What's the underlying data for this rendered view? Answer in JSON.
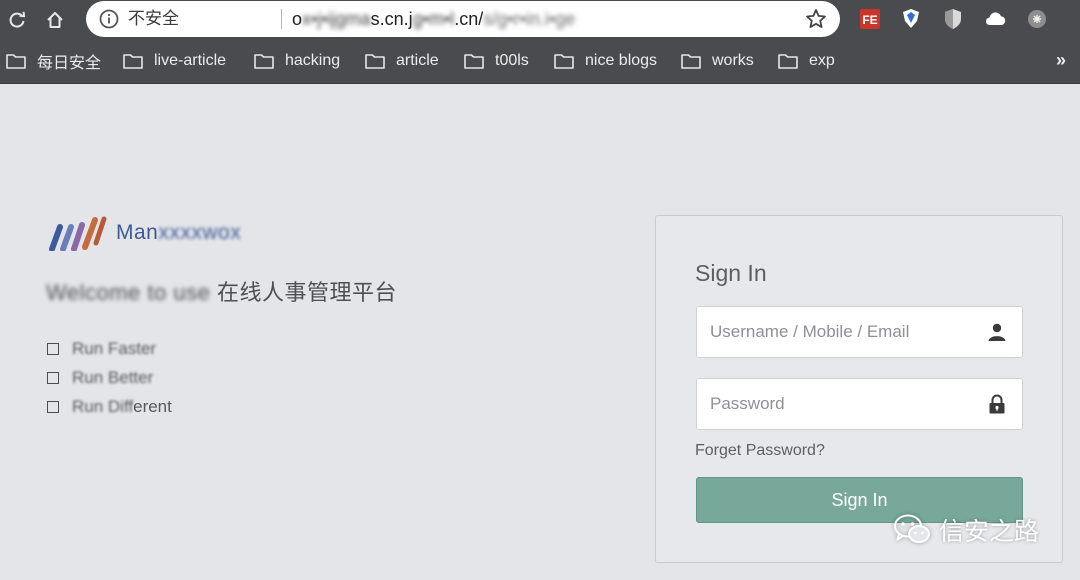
{
  "browser": {
    "security_label": "不安全",
    "url": {
      "part1": "o",
      "part2": "x•j•ijgma",
      "part3": "s.cn.j",
      "part4": "g•m•l",
      "part5": ".cn/",
      "part6": "s/g•r•i",
      "part7": "n.i•ge"
    }
  },
  "extensions": [
    "fe-extension-icon",
    "shield-diamond-icon",
    "shield-icon",
    "cloud-icon",
    "grey-badge-icon"
  ],
  "fe_label": "FE",
  "bookmarks": {
    "items": [
      {
        "label": "每日安全"
      },
      {
        "label": "live-article"
      },
      {
        "label": "hacking"
      },
      {
        "label": "article"
      },
      {
        "label": "t00ls"
      },
      {
        "label": "nice blogs"
      },
      {
        "label": "works"
      },
      {
        "label": "exp"
      }
    ],
    "more": "»"
  },
  "brand": {
    "name_clear": "Man",
    "name_blurred": "xxxxwox",
    "colors": [
      "#3d5a9b",
      "#6a7fb5",
      "#8a6aa6",
      "#c66a3f",
      "#b65a3a"
    ]
  },
  "welcome": {
    "blurred": "Welcome to use",
    "visible": "在线人事管理平台"
  },
  "features": [
    {
      "visible": "",
      "blurred": "Run Faster"
    },
    {
      "visible": "",
      "blurred": "Run Better"
    },
    {
      "visible": "",
      "blurred": "Run Diff",
      "tail": "erent"
    }
  ],
  "login": {
    "title": "Sign In",
    "username_placeholder": "Username / Mobile / Email",
    "password_placeholder": "Password",
    "forgot": "Forget Password?",
    "submit": "Sign In",
    "accent": "#77a89a"
  },
  "watermark": {
    "text": "信安之路"
  }
}
